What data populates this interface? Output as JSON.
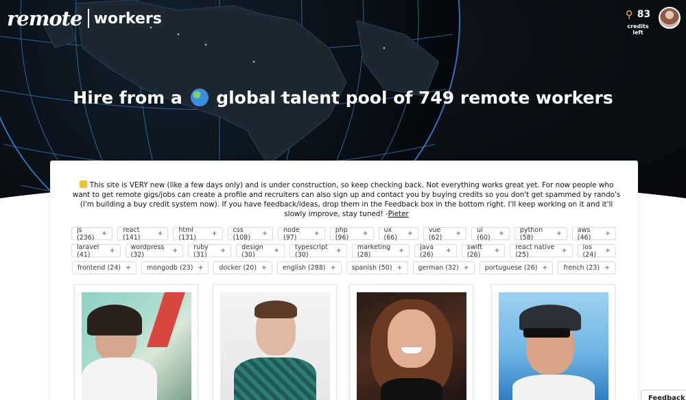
{
  "brand": {
    "remote": "remote",
    "workers": "workers"
  },
  "credits": {
    "count": "83",
    "label": "credits left",
    "icon": "key-icon"
  },
  "headline": {
    "before": "Hire from a",
    "after": "global talent pool of 749 remote workers"
  },
  "notice": {
    "text": "This site is VERY new (like a few days only) and is under construction, so keep checking back. Not everything works great yet. For now people who want to get remote gigs/jobs can create a profile and recruiters can also sign up and contact you by buying credits so you don't get spammed by rando's (I'm building a buy credit system now). If you have feedback/ideas, drop them in the Feedback box in the bottom right. I'll keep working on it and it'll slowly improve, stay tuned! -",
    "author": "Pieter"
  },
  "tags": [
    [
      "js (236)",
      "react (141)",
      "html (131)",
      "css (108)",
      "node (97)",
      "php (96)",
      "ux (66)",
      "vue (62)",
      "ui (60)",
      "python (58)",
      "aws (46)"
    ],
    [
      "laravel (41)",
      "wordpress (32)",
      "ruby (31)",
      "design (30)",
      "typescript (30)",
      "marketing (28)",
      "java (26)",
      "swift (26)",
      "react native (25)",
      "ios (24)"
    ],
    [
      "frontend (24)",
      "mongodb (23)",
      "docker (20)",
      "english (288)",
      "spanish (50)",
      "german (32)",
      "portuguese (26)",
      "french (23)"
    ]
  ],
  "tag_plus": "+",
  "feedback": {
    "label": "Feedback"
  },
  "colors": {
    "hero_bg": "#0c1117",
    "key": "#f2b531",
    "grid": "#3c7fc4"
  }
}
